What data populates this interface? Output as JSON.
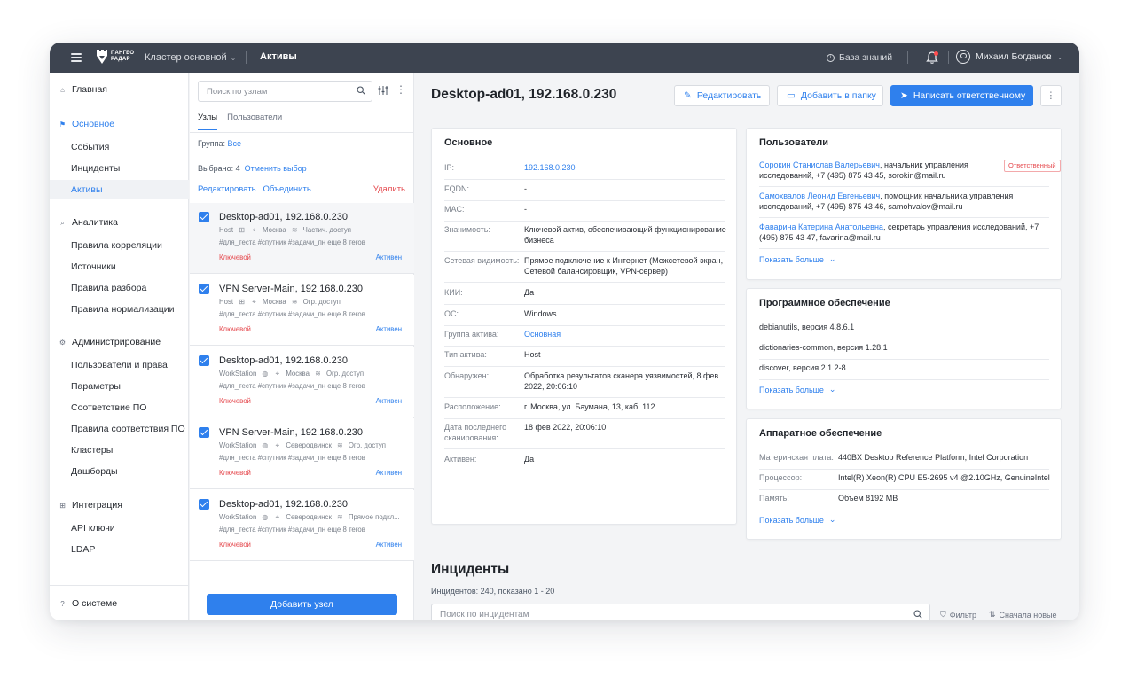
{
  "topbar": {
    "logo_line1": "ПАНГЕО",
    "logo_line2": "РАДАР",
    "cluster": "Кластер основной",
    "section": "Активы",
    "knowledge": "База знаний",
    "user": "Михаил Богданов"
  },
  "sidebar": {
    "home": "Главная",
    "basic": "Основное",
    "basic_items": [
      "События",
      "Инциденты",
      "Активы"
    ],
    "analytics": "Аналитика",
    "analytics_items": [
      "Правила корреляции",
      "Источники",
      "Правила разбора",
      "Правила нормализации"
    ],
    "admin": "Администрирование",
    "admin_items": [
      "Пользователи и права",
      "Параметры",
      "Соответствие ПО",
      "Правила соответствия ПО",
      "Кластеры",
      "Дашборды"
    ],
    "integration": "Интеграция",
    "integration_items": [
      "API ключи",
      "LDAP"
    ],
    "about": "О системе"
  },
  "list": {
    "search_placeholder": "Поиск по узлам",
    "tabs": [
      "Узлы",
      "Пользователи"
    ],
    "group_label": "Группа:",
    "group_value": "Все",
    "selected_label": "Выбрано: 4",
    "cancel_selection": "Отменить выбор",
    "edit": "Редактировать",
    "merge": "Объединить",
    "delete": "Удалить",
    "add_node": "Добавить узел",
    "cards": [
      {
        "title": "Desktop-ad01, 192.168.0.230",
        "type": "Host",
        "city": "Москва",
        "access": "Частич. доступ",
        "tags": "#для_теста   #спутник   #задачи_пн   еще 8 тегов",
        "importance": "Ключевой",
        "status": "Активен"
      },
      {
        "title": "VPN Server-Main, 192.168.0.230",
        "type": "Host",
        "city": "Москва",
        "access": "Огр. доступ",
        "tags": "#для_теста   #спутник   #задачи_пн   еще 8 тегов",
        "importance": "Ключевой",
        "status": "Активен"
      },
      {
        "title": "Desktop-ad01, 192.168.0.230",
        "type": "WorkStation",
        "city": "Москва",
        "access": "Огр. доступ",
        "tags": "#для_теста   #спутник   #задачи_пн   еще 8 тегов",
        "importance": "Ключевой",
        "status": "Активен"
      },
      {
        "title": "VPN Server-Main, 192.168.0.230",
        "type": "WorkStation",
        "city": "Северодвинск",
        "access": "Огр. доступ",
        "tags": "#для_теста   #спутник   #задачи_пн   еще 8 тегов",
        "importance": "Ключевой",
        "status": "Активен"
      },
      {
        "title": "Desktop-ad01, 192.168.0.230",
        "type": "WorkStation",
        "city": "Северодвинск",
        "access": "Прямое подкл...",
        "tags": "#для_теста   #спутник   #задачи_пн   еще 8 тегов",
        "importance": "Ключевой",
        "status": "Активен"
      }
    ]
  },
  "main": {
    "title": "Desktop-ad01, 192.168.0.230",
    "btn_edit": "Редактировать",
    "btn_folder": "Добавить в папку",
    "btn_write": "Написать ответственному",
    "basic": {
      "title": "Основное",
      "rows": [
        {
          "k": "IP:",
          "v": "192.168.0.230"
        },
        {
          "k": "FQDN:",
          "v": "-"
        },
        {
          "k": "MAC:",
          "v": "-"
        },
        {
          "k": "Значимость:",
          "v": "Ключевой актив, обеспечивающий функционирование бизнеса"
        },
        {
          "k": "Сетевая видимость:",
          "v": "Прямое подключение к Интернет (Межсетевой экран, Сетевой балансировщик, VPN-сервер)"
        },
        {
          "k": "КИИ:",
          "v": "Да"
        },
        {
          "k": "ОС:",
          "v": "Windows"
        },
        {
          "k": "Группа актива:",
          "v": "Основная"
        },
        {
          "k": "Тип актива:",
          "v": "Host"
        },
        {
          "k": "Обнаружен:",
          "v": "Обработка результатов сканера уязвимостей, 8 фев 2022, 20:06:10"
        },
        {
          "k": "Расположение:",
          "v": "г. Москва, ул. Баумана, 13, каб. 112"
        },
        {
          "k": "Дата последнего сканирования:",
          "v": "18 фев 2022, 20:06:10"
        },
        {
          "k": "Активен:",
          "v": "Да"
        }
      ]
    },
    "users": {
      "title": "Пользователи",
      "badge": "Ответственный",
      "rows": [
        {
          "name": "Сорокин Станислав Валерьевич",
          "rest": ", начальник управления исследований, +7 (495) 875 43 45, sorokin@mail.ru"
        },
        {
          "name": "Самохвалов Леонид Евгеньевич",
          "rest": ", помощник начальника управления исследований, +7 (495) 875 43 46, samohvalov@mail.ru"
        },
        {
          "name": "Фаварина Катерина Анатольевна",
          "rest": ", секретарь управления исследований, +7 (495) 875 43 47, favarina@mail.ru"
        }
      ],
      "more": "Показать больше"
    },
    "software": {
      "title": "Программное обеспечение",
      "rows": [
        "debianutils, версия 4.8.6.1",
        "dictionaries-common, версия 1.28.1",
        "discover, версия 2.1.2-8"
      ],
      "more": "Показать больше"
    },
    "hardware": {
      "title": "Аппаратное обеспечение",
      "rows": [
        {
          "k": "Материнская плата:",
          "v": "440BX Desktop Reference Platform, Intel Corporation"
        },
        {
          "k": "Процессор:",
          "v": "Intel(R) Xeon(R) CPU E5-2695 v4 @2.10GHz, GenuineIntel"
        },
        {
          "k": "Память:",
          "v": "Объем 8192 MB"
        }
      ],
      "more": "Показать больше"
    },
    "incidents": {
      "title": "Инциденты",
      "meta": "Инцидентов: 240, показано 1 - 20",
      "search_placeholder": "Поиск по инцидентам",
      "filter": "Фильтр",
      "sort": "Сначала новые"
    }
  }
}
